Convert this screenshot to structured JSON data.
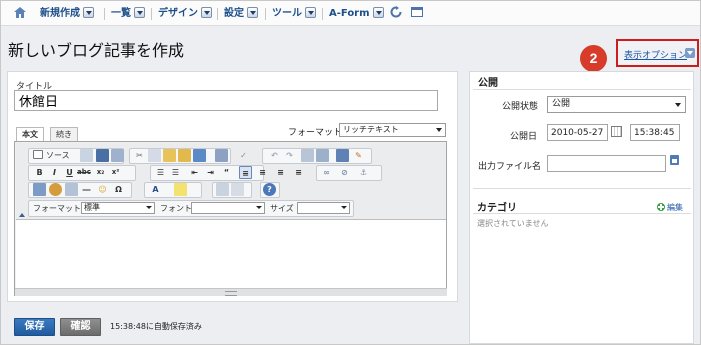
{
  "nav": {
    "items": [
      {
        "label": "新規作成"
      },
      {
        "label": "一覧"
      },
      {
        "label": "デザイン"
      },
      {
        "label": "設定"
      },
      {
        "label": "ツール"
      },
      {
        "label": "A-Form"
      }
    ],
    "icons": [
      "home-icon",
      "refresh-icon",
      "window-icon"
    ]
  },
  "page": {
    "title": "新しいブログ記事を作成",
    "step_badge": "2",
    "display_options": "表示オプション"
  },
  "editor": {
    "title_label": "タイトル",
    "title_value": "休館日",
    "tabs": [
      "本文",
      "続き"
    ],
    "format_label": "フォーマット:",
    "format_value": "リッチテキスト",
    "toolbar": {
      "source": "ソース",
      "format_label": "フォーマット",
      "format_value": "標準",
      "font_label": "フォント",
      "font_value": "",
      "size_label": "サイズ",
      "size_value": ""
    }
  },
  "actions": {
    "save": "保存",
    "confirm": "確認",
    "autosave": "15:38:48に自動保存済み"
  },
  "publish": {
    "heading": "公開",
    "status_label": "公開状態",
    "status_value": "公開",
    "date_label": "公開日",
    "date_value": "2010-05-27",
    "time_value": "15:38:45",
    "filename_label": "出力ファイル名",
    "filename_value": ""
  },
  "category": {
    "heading": "カテゴリ",
    "edit": "編集",
    "empty": "選択されていません"
  },
  "colors": {
    "accent": "#1d4f8a",
    "save_button": "#2a64a8",
    "badge": "#d63c29",
    "highlight_box": "#cc1c1c"
  }
}
